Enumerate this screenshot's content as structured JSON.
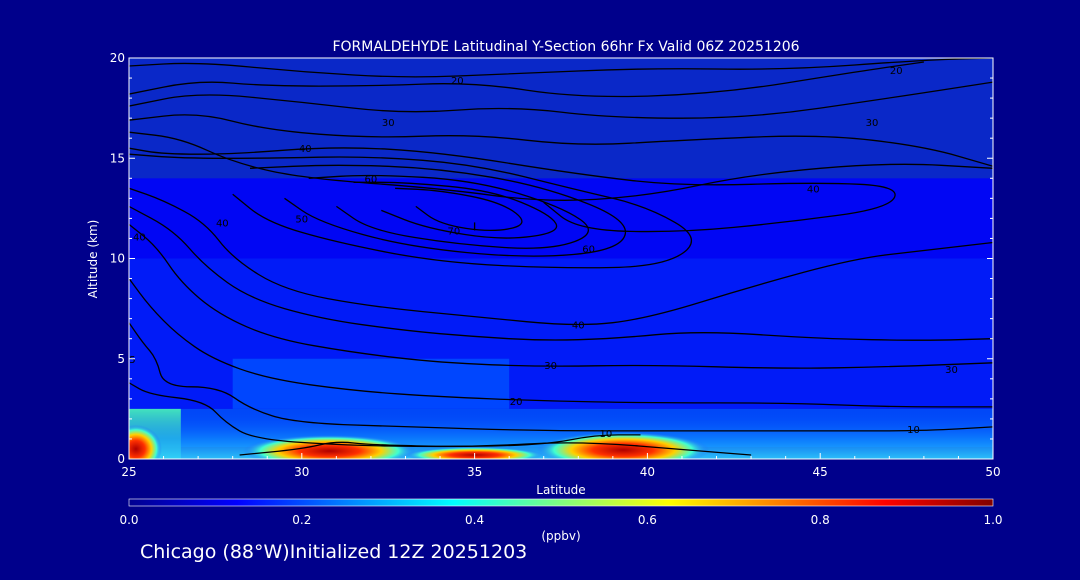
{
  "chart_data": {
    "type": "heatmap",
    "title": "FORMALDEHYDE Latitudinal Y-Section 66hr  Fx Valid 06Z 20251206",
    "xlabel": "Latitude",
    "ylabel": "Altitude (km)",
    "xlim": [
      25,
      50
    ],
    "ylim": [
      0,
      20
    ],
    "x_ticks": [
      "25",
      "30",
      "35",
      "40",
      "45",
      "50"
    ],
    "y_ticks": [
      "0",
      "5",
      "10",
      "15",
      "20"
    ],
    "colorbar": {
      "label": "(ppbv)",
      "range": [
        0.0,
        1.0
      ],
      "ticks": [
        "0.0",
        "0.2",
        "0.4",
        "0.6",
        "0.8",
        "1.0"
      ]
    },
    "grid": false,
    "background_field": [
      {
        "lat": [
          25,
          50
        ],
        "alt": [
          0.6,
          2.5
        ],
        "value": 0.2
      },
      {
        "lat": [
          25,
          50
        ],
        "alt": [
          2.5,
          10
        ],
        "value": 0.15
      },
      {
        "lat": [
          25,
          50
        ],
        "alt": [
          10,
          14
        ],
        "value": 0.12
      },
      {
        "lat": [
          28,
          36
        ],
        "alt": [
          2.5,
          5
        ],
        "value": 0.2
      },
      {
        "lat": [
          25,
          26.5
        ],
        "alt": [
          0,
          2.5
        ],
        "value": 0.45
      }
    ],
    "hotspots": [
      {
        "lat": 30.8,
        "alt": 0.4,
        "value": 0.85,
        "lat_width": 5,
        "alt_height": 0.8
      },
      {
        "lat": 39.3,
        "alt": 0.45,
        "value": 0.9,
        "lat_width": 5,
        "alt_height": 0.9
      },
      {
        "lat": 35.0,
        "alt": 0.2,
        "value": 0.7,
        "lat_width": 4,
        "alt_height": 0.4
      },
      {
        "lat": 25.2,
        "alt": 0.5,
        "value": 0.6,
        "lat_width": 1.5,
        "alt_height": 1.2
      }
    ],
    "contour_labels": [
      {
        "text": "20",
        "lat": 34.5,
        "alt": 18.9
      },
      {
        "text": "20",
        "lat": 47.2,
        "alt": 19.4
      },
      {
        "text": "30",
        "lat": 32.5,
        "alt": 16.8
      },
      {
        "text": "30",
        "lat": 46.5,
        "alt": 16.8
      },
      {
        "text": "40",
        "lat": 30.1,
        "alt": 15.5
      },
      {
        "text": "40",
        "lat": 44.8,
        "alt": 13.5
      },
      {
        "text": "60",
        "lat": 32.0,
        "alt": 14.0
      },
      {
        "text": "70",
        "lat": 34.4,
        "alt": 11.4
      },
      {
        "text": "50",
        "lat": 30.0,
        "alt": 12.0
      },
      {
        "text": "60",
        "lat": 38.3,
        "alt": 10.5
      },
      {
        "text": "40",
        "lat": 27.7,
        "alt": 11.8
      },
      {
        "text": "40",
        "lat": 25.3,
        "alt": 11.1
      },
      {
        "text": "40",
        "lat": 38.0,
        "alt": 6.7
      },
      {
        "text": "30",
        "lat": 37.2,
        "alt": 4.7
      },
      {
        "text": "30",
        "lat": 48.8,
        "alt": 4.5
      },
      {
        "text": "20",
        "lat": 36.2,
        "alt": 2.9
      },
      {
        "text": "10",
        "lat": 38.8,
        "alt": 1.3
      },
      {
        "text": "10",
        "lat": 47.7,
        "alt": 1.5
      },
      {
        "text": "5",
        "lat": 25.1,
        "alt": 5.0
      }
    ]
  },
  "footer_text": "Chicago (88°W)Initialized 12Z 20251203"
}
